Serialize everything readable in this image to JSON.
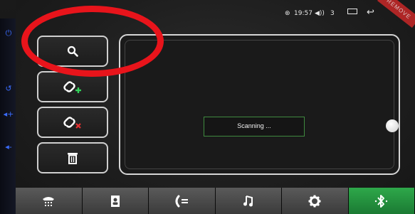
{
  "status_bar": {
    "time": "19:57",
    "volume": "3",
    "badge": "REMOVE"
  },
  "side_buttons": [
    {
      "name": "search",
      "icon": "search-icon"
    },
    {
      "name": "add-device",
      "icon": "link-add-icon"
    },
    {
      "name": "remove-device",
      "icon": "link-remove-icon"
    },
    {
      "name": "delete",
      "icon": "trash-icon"
    }
  ],
  "main": {
    "status_message": "Scanning ..."
  },
  "nav": {
    "tabs": [
      {
        "name": "dialpad",
        "icon": "dialpad-icon"
      },
      {
        "name": "contacts",
        "icon": "contacts-icon"
      },
      {
        "name": "call-log",
        "icon": "call-log-icon"
      },
      {
        "name": "music",
        "icon": "music-icon"
      },
      {
        "name": "settings",
        "icon": "gear-icon"
      },
      {
        "name": "bluetooth",
        "icon": "bluetooth-icon",
        "active": true
      }
    ]
  },
  "colors": {
    "accent_green": "#2ea84a",
    "annotation_red": "#e8141b",
    "side_glyph_blue": "#3a6cff"
  }
}
